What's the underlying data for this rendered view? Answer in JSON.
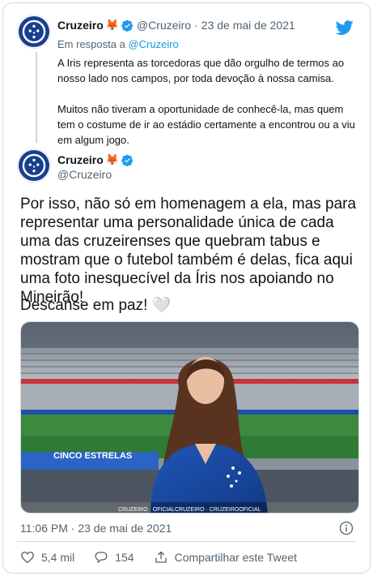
{
  "reply_tweet": {
    "name": "Cruzeiro",
    "handle": "@Cruzeiro",
    "separator": "·",
    "date": "23 de mai de 2021",
    "reply_prefix": "Em resposta a",
    "reply_mention": "@Cruzeiro",
    "paragraph1": "A Iris representa as torcedoras que dão orgulho de termos ao nosso lado nos campos, por toda devoção à nossa camisa.",
    "paragraph2": "Muitos não tiveram a oportunidade de conhecê-la, mas quem tem o costume de ir ao estádio certamente a encontrou ou a viu em algum jogo."
  },
  "main_tweet": {
    "name": "Cruzeiro",
    "handle": "@Cruzeiro",
    "text": "Por isso, não só em homenagem a ela, mas para representar uma personalidade única de cada uma das cruzeirenses que quebram tabus e mostram que o futebol também é delas, fica aqui uma foto inesquecível da Íris nos apoiando no Mineirão!",
    "text2": "Descanse em paz! 🤍",
    "timestamp": "11:06 PM · 23 de mai de 2021",
    "photo_watermark": "CRUZEIRO  ·  OFICIALCRUZEIRO  ·  CRUZEIROOFICIAL",
    "photo_ad_text": "CINCO ESTRELAS"
  },
  "actions": {
    "likes": "5,4 mil",
    "replies": "154",
    "share_label": "Compartilhar este Tweet"
  },
  "colors": {
    "brand_blue": "#1d9bf0",
    "cruzeiro_blue": "#1a3f8f",
    "text_secondary": "#536471"
  },
  "icons": {
    "twitter": "twitter-bird-icon",
    "verified": "verified-badge-icon",
    "emoji": "fox-emoji",
    "info": "info-icon",
    "like": "heart-icon",
    "reply": "reply-icon",
    "share": "share-icon"
  }
}
